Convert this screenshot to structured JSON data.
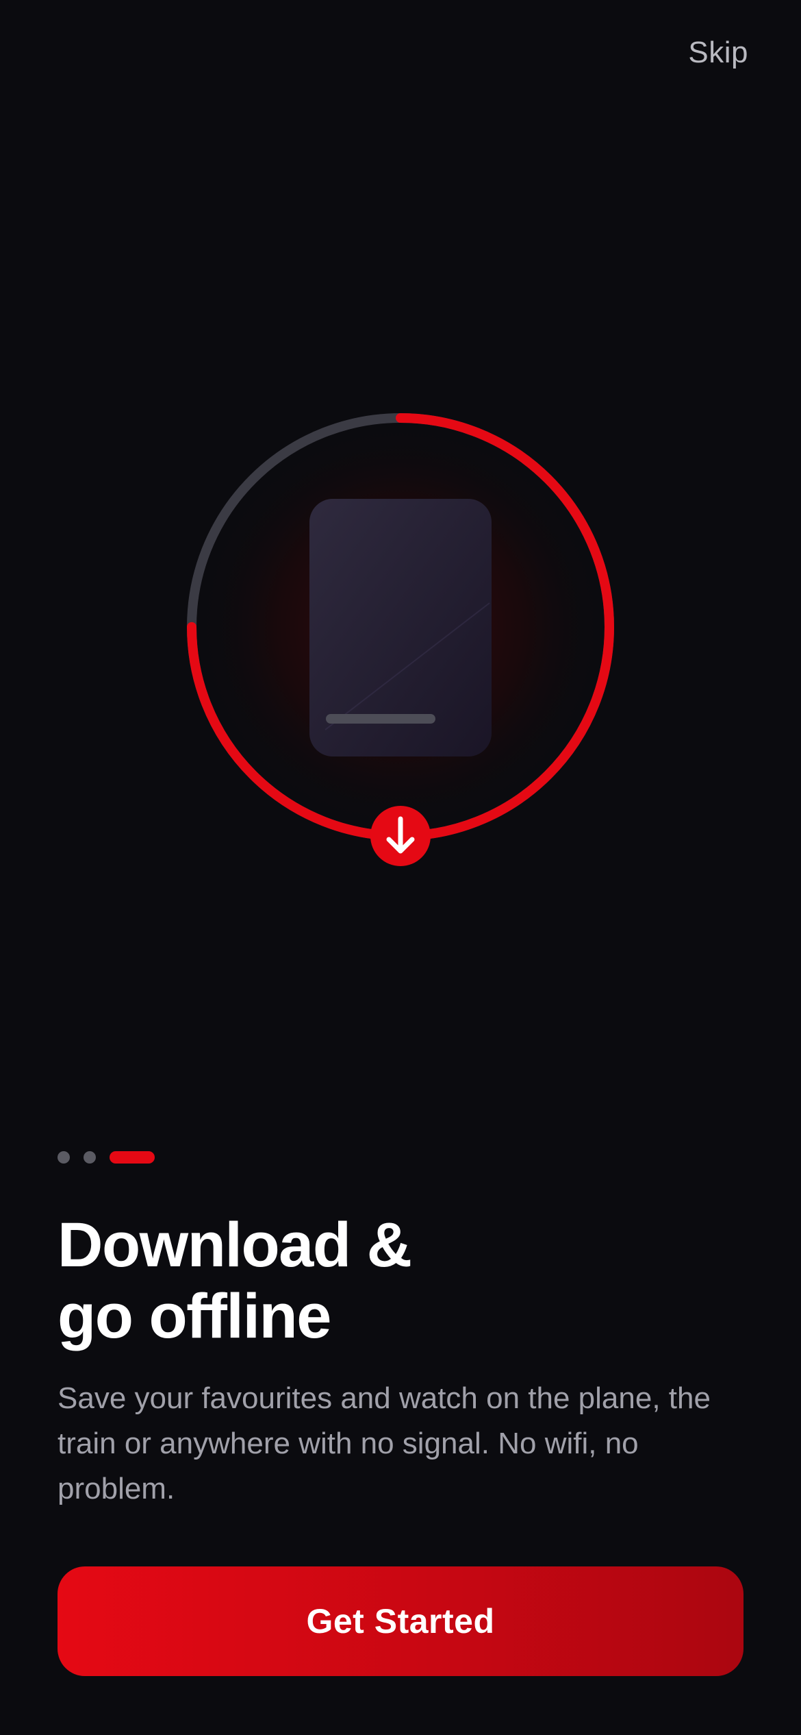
{
  "header": {
    "skip_label": "Skip"
  },
  "hero": {
    "illustration": "phone-download-illustration",
    "download_progress": 0.75,
    "icons": {
      "device": "phone-icon",
      "download": "download-arrow-icon"
    }
  },
  "pagination": {
    "total": 3,
    "active_index": 2
  },
  "onboarding": {
    "title_line1": "Download &",
    "title_line2": "go offline",
    "description": "Save your favourites and watch on the plane, the train or anywhere with no signal. No wifi, no problem."
  },
  "cta": {
    "label": "Get Started"
  },
  "colors": {
    "background": "#0b0b0f",
    "accent": "#e50914",
    "text_primary": "#ffffff",
    "text_secondary": "#a1a1aa",
    "dot_inactive": "#5b5b63"
  }
}
